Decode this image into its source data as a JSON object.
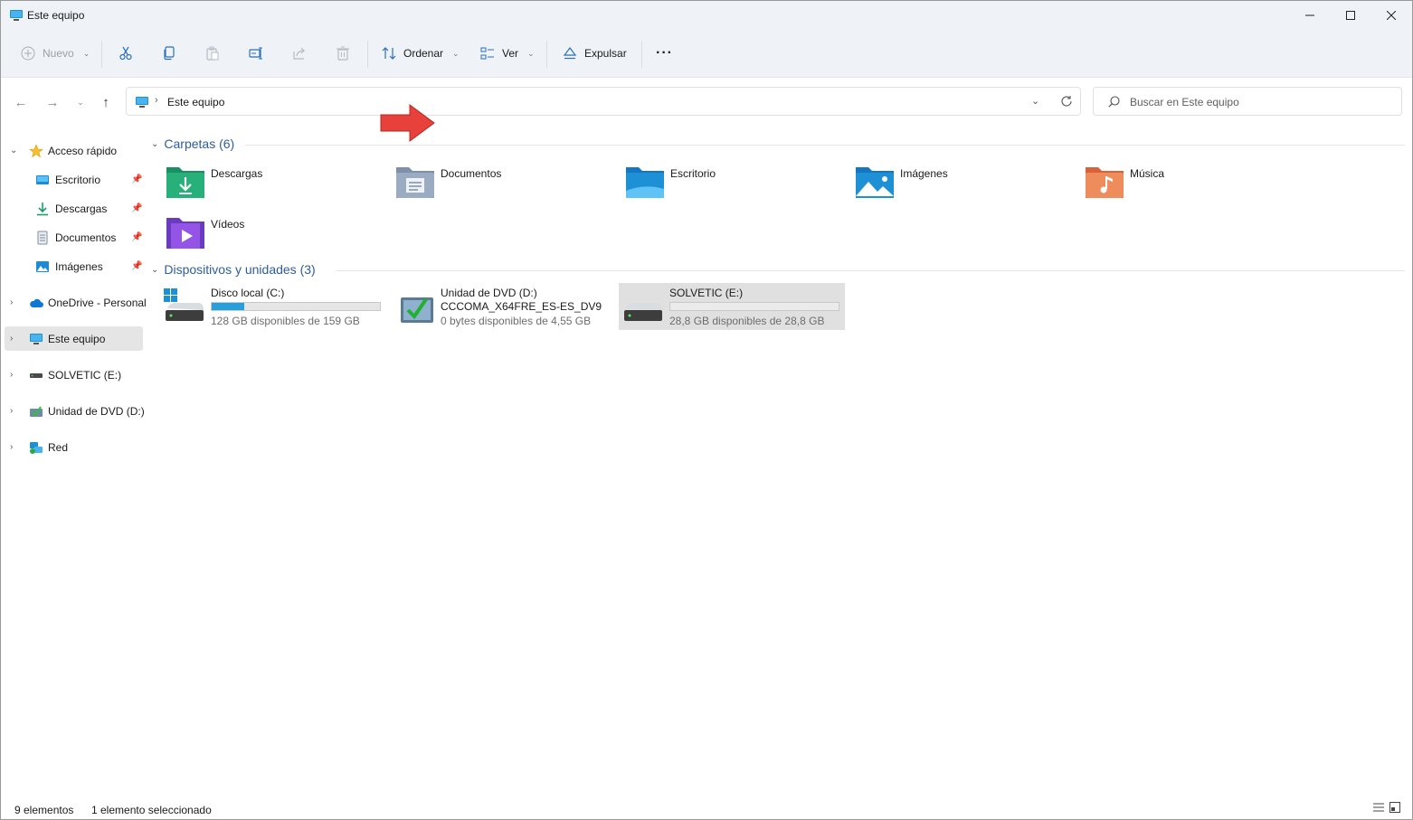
{
  "window": {
    "title": "Este equipo"
  },
  "toolbar": {
    "new_label": "Nuevo",
    "sort_label": "Ordenar",
    "view_label": "Ver",
    "eject_label": "Expulsar",
    "more_label": "···"
  },
  "address": {
    "path": "Este equipo",
    "search_placeholder": "Buscar en Este equipo"
  },
  "sidebar": {
    "quick_access": "Acceso rápido",
    "items": [
      "Escritorio",
      "Descargas",
      "Documentos",
      "Imágenes"
    ],
    "onedrive": "OneDrive - Personal",
    "this_pc": "Este equipo",
    "usb": "SOLVETIC (E:)",
    "dvd": "Unidad de DVD (D:)",
    "network": "Red"
  },
  "folders": {
    "header": "Carpetas (6)",
    "items": [
      "Descargas",
      "Documentos",
      "Escritorio",
      "Imágenes",
      "Música",
      "Vídeos"
    ]
  },
  "devices": {
    "header": "Dispositivos y unidades (3)",
    "c": {
      "name": "Disco local (C:)",
      "free": "128 GB disponibles de 159 GB",
      "used_fraction": 0.195
    },
    "d": {
      "name": "Unidad de DVD (D:)",
      "label": "CCCOMA_X64FRE_ES-ES_DV9",
      "free": "0 bytes disponibles de 4,55 GB"
    },
    "e": {
      "name": "SOLVETIC (E:)",
      "free": "28,8 GB disponibles de 28,8 GB",
      "used_fraction": 0.0
    }
  },
  "status": {
    "count": "9 elementos",
    "selection": "1 elemento seleccionado"
  },
  "colors": {
    "accent": "#26a0da",
    "header_text": "#2e5d9a",
    "chrome_bg": "#eff3f8",
    "arrow": "#e8403a"
  }
}
